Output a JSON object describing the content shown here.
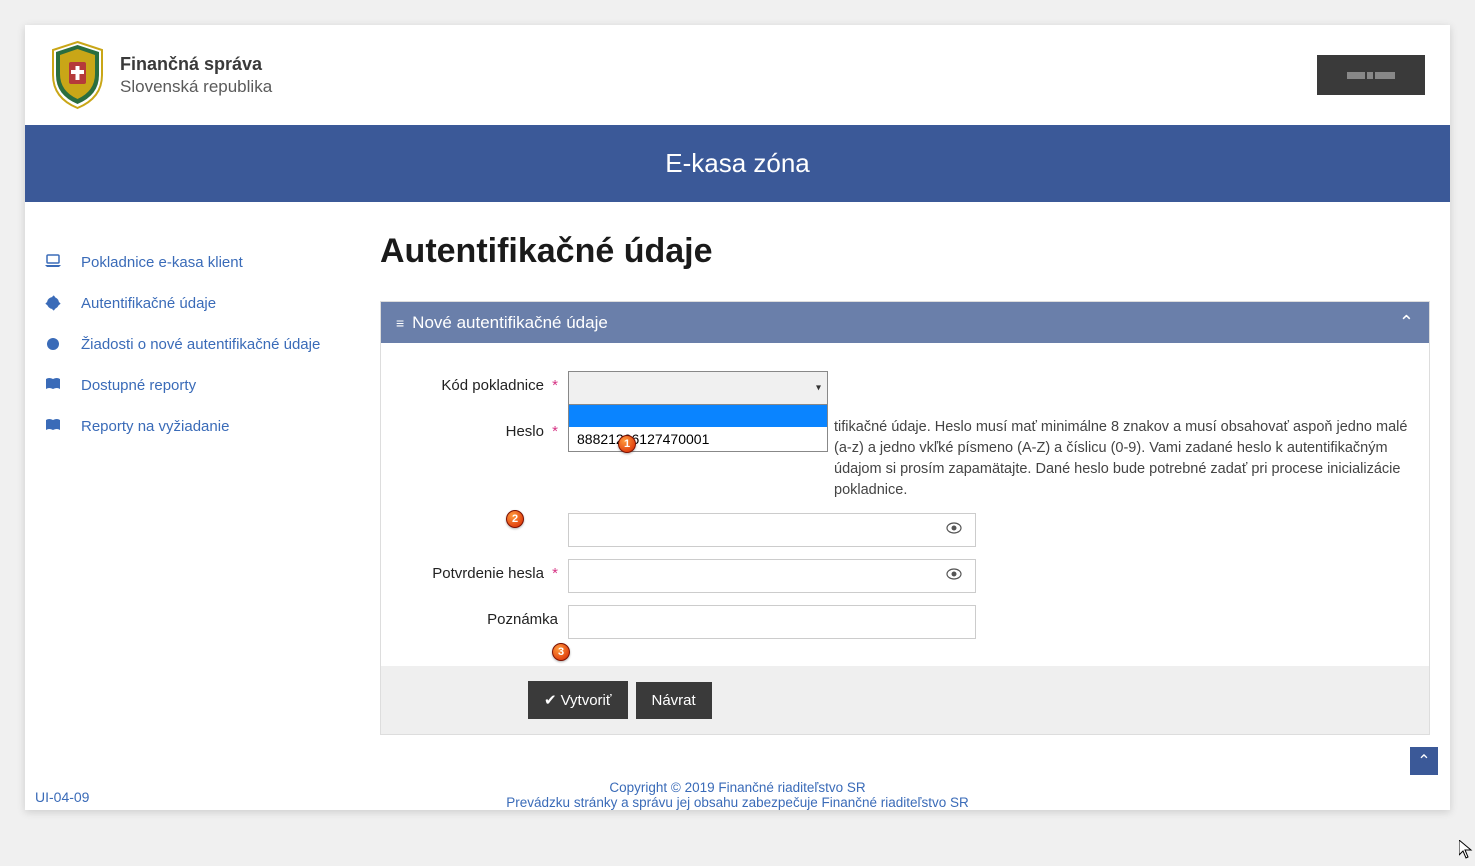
{
  "header": {
    "org_name": "Finančná správa",
    "org_sub": "Slovenská republika"
  },
  "zone_title": "E-kasa zóna",
  "sidebar": {
    "items": [
      {
        "label": "Pokladnice e-kasa klient",
        "icon": "laptop"
      },
      {
        "label": "Autentifikačné údaje",
        "icon": "seal"
      },
      {
        "label": "Žiadosti o nové autentifikačné údaje",
        "icon": "seal"
      },
      {
        "label": "Dostupné reporty",
        "icon": "book"
      },
      {
        "label": "Reporty na vyžiadanie",
        "icon": "book"
      }
    ]
  },
  "page_title": "Autentifikačné údaje",
  "panel": {
    "title": "Nové autentifikačné údaje",
    "fields": {
      "kod_label": "Kód pokladnice",
      "heslo_label": "Heslo",
      "potvrdenie_label": "Potvrdenie hesla",
      "poznamka_label": "Poznámka"
    },
    "dropdown_options": [
      {
        "value": "",
        "selected": true
      },
      {
        "value": "88821206127470001",
        "selected": false
      }
    ],
    "help_text": "tifikačné údaje. Heslo musí mať minimálne 8 znakov a musí obsahovať aspoň jedno malé (a-z) a jedno vkľké písmeno (A-Z) a číslicu (0-9). Vami zadané heslo k autentifikačným údajom si prosím zapamätajte. Dané heslo bude potrebné zadať pri procese inicializácie pokladnice.",
    "buttons": {
      "create": "Vytvoriť",
      "back": "Návrat"
    }
  },
  "annotations": {
    "a1": "1",
    "a2": "2",
    "a3": "3"
  },
  "footer": {
    "copyright": "Copyright © 2019 Finančné riaditeľstvo SR",
    "operation": "Prevádzku stránky a správu jej obsahu zabezpečuje Finančné riaditeľstvo SR",
    "version": "UI-04-09"
  }
}
